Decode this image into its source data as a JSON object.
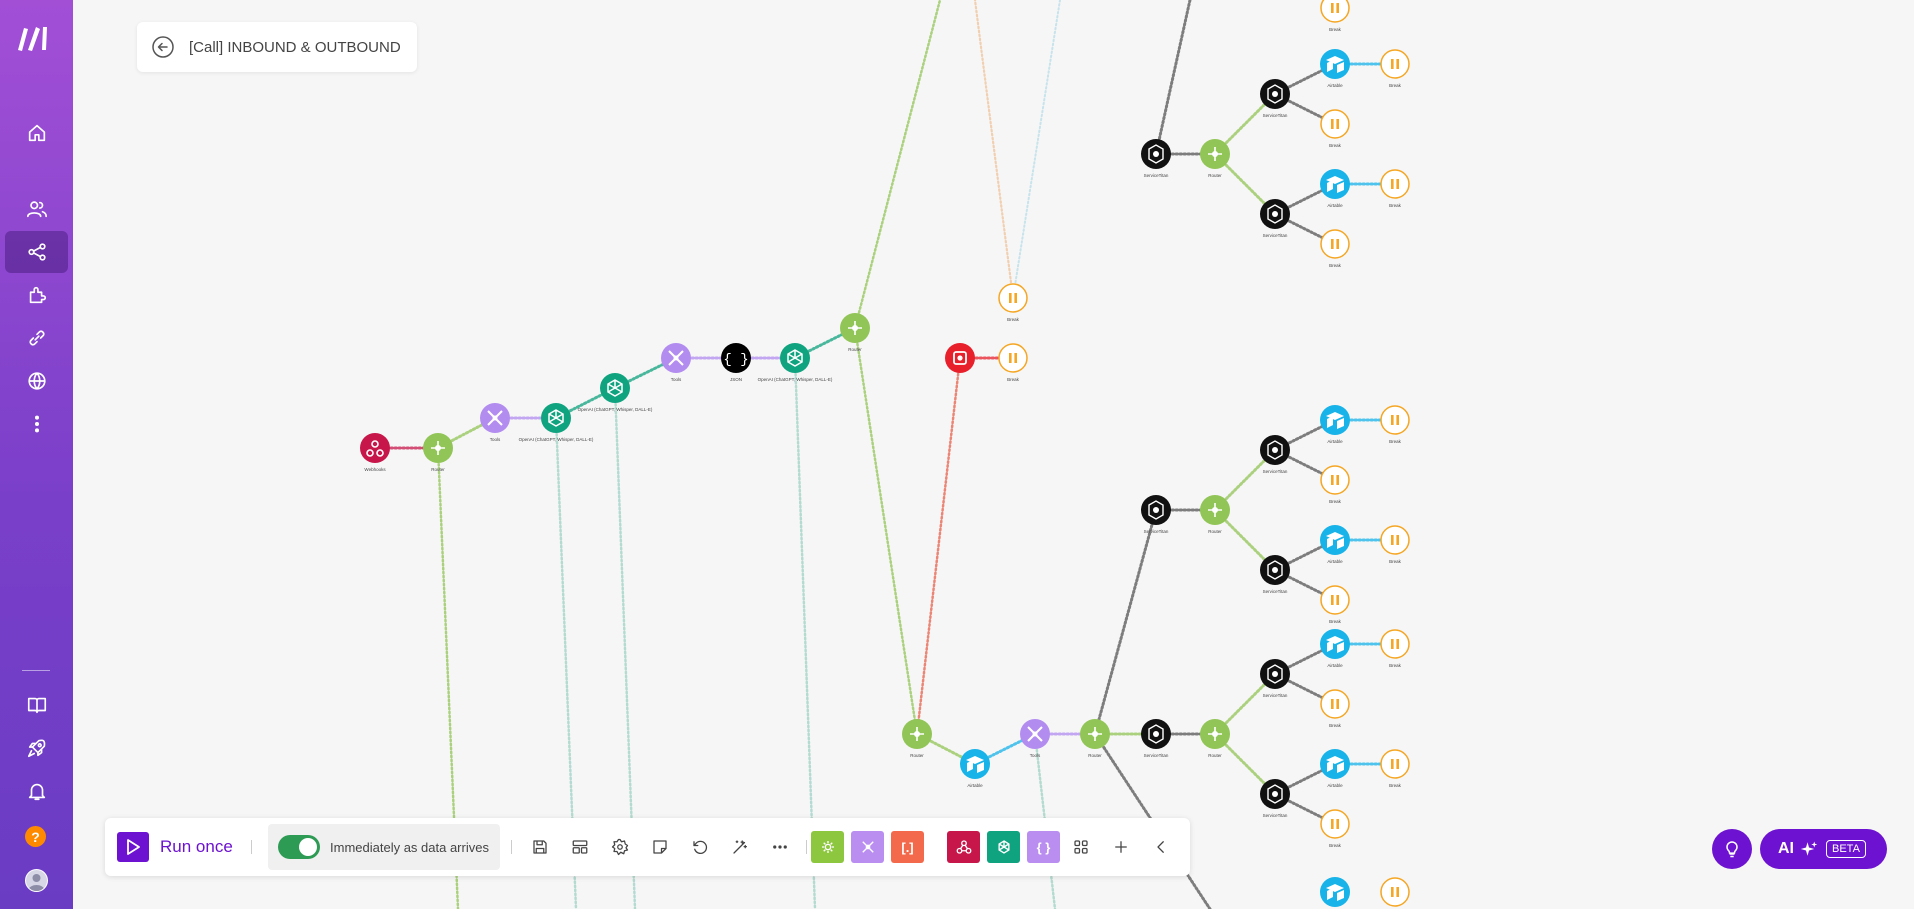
{
  "app": {
    "title": "[Call] INBOUND & OUTBOUND",
    "brand_color": "#6d12d0"
  },
  "sidebar": {
    "items": [
      {
        "name": "home-icon"
      },
      {
        "name": "team-icon"
      },
      {
        "name": "scenarios-icon",
        "active": true
      },
      {
        "name": "apps-icon"
      },
      {
        "name": "connections-icon"
      },
      {
        "name": "webhooks-icon"
      },
      {
        "name": "more-icon"
      }
    ],
    "bottom_items": [
      {
        "name": "docs-icon"
      },
      {
        "name": "rocket-icon"
      },
      {
        "name": "notifications-icon"
      },
      {
        "name": "help-icon",
        "label": "?"
      },
      {
        "name": "avatar"
      }
    ]
  },
  "toolbar": {
    "run_label": "Run once",
    "schedule_label": "Immediately as data arrives",
    "schedule_on": true,
    "tools": [
      "save-icon",
      "explain-flow-icon",
      "settings-icon",
      "notes-icon",
      "history-icon",
      "auto-align-icon",
      "more-icon"
    ],
    "quick_apps": [
      {
        "name": "tools-app",
        "color": "#8dc63f"
      },
      {
        "name": "flow-control-app",
        "color": "#b98ef0"
      },
      {
        "name": "text-parser-app",
        "color": "#f26a4b",
        "label": "[.]"
      },
      {
        "name": "webhooks-app",
        "color": "#c7174a"
      },
      {
        "name": "openai-app",
        "color": "#10a37f"
      },
      {
        "name": "json-app",
        "color": "#b98ef0",
        "label": "{ }"
      }
    ]
  },
  "ai": {
    "label": "AI",
    "badge": "BETA"
  },
  "modules": {
    "webhooks": "Webhooks",
    "router": "Router",
    "tools": "Tools",
    "openai": "OpenAI (ChatGPT, Whisper, DALL-E)",
    "json": "JSON",
    "airtable": "Airtable",
    "servicetitan": "ServiceTitan",
    "break": "Break",
    "colors": {
      "router": "#92c557",
      "tools": "#b38cf0",
      "openai": "#10a37f",
      "webhooks": "#c7174a",
      "airtable": "#18b3e9",
      "servicetitan": "#111111",
      "break": "#f5a623",
      "stop": "#e8202b"
    }
  }
}
